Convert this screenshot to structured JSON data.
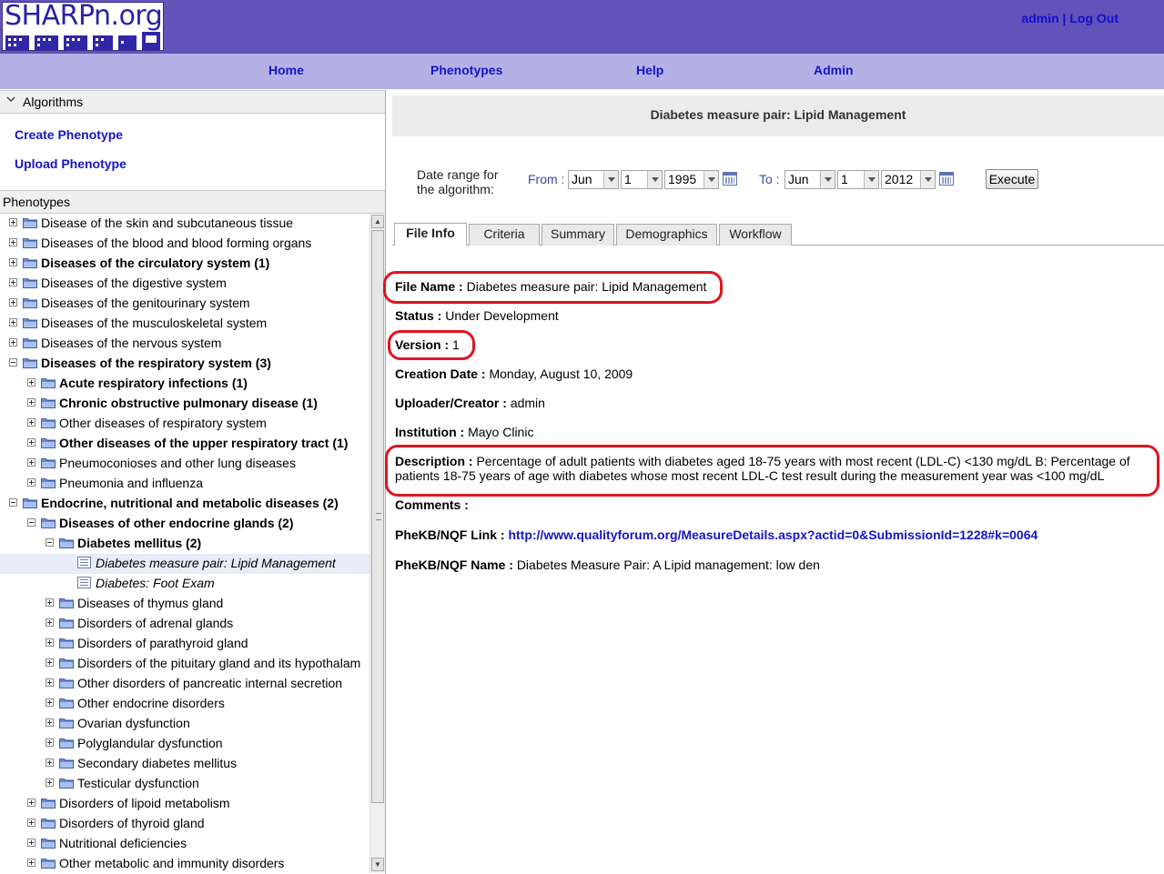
{
  "header": {
    "logo_text": "SHARPn.org",
    "user": "admin",
    "separator": "|",
    "logout": "Log Out"
  },
  "nav": {
    "items": [
      "Home",
      "Phenotypes",
      "Help",
      "Admin"
    ]
  },
  "algorithms": {
    "title": "Algorithms",
    "links": [
      "Create Phenotype",
      "Upload Phenotype"
    ]
  },
  "phenotypes": {
    "title": "Phenotypes",
    "tree": [
      {
        "label": "Disease of the skin and subcutaneous tissue",
        "level": 0,
        "type": "folder",
        "state": "collapsed",
        "bold": false
      },
      {
        "label": "Diseases of the blood and blood forming organs",
        "level": 0,
        "type": "folder",
        "state": "collapsed",
        "bold": false
      },
      {
        "label": "Diseases of the circulatory system (1)",
        "level": 0,
        "type": "folder",
        "state": "collapsed",
        "bold": true
      },
      {
        "label": "Diseases of the digestive system",
        "level": 0,
        "type": "folder",
        "state": "collapsed",
        "bold": false
      },
      {
        "label": "Diseases of the genitourinary system",
        "level": 0,
        "type": "folder",
        "state": "collapsed",
        "bold": false
      },
      {
        "label": "Diseases of the musculoskeletal system",
        "level": 0,
        "type": "folder",
        "state": "collapsed",
        "bold": false
      },
      {
        "label": "Diseases of the nervous system",
        "level": 0,
        "type": "folder",
        "state": "collapsed",
        "bold": false
      },
      {
        "label": "Diseases of the respiratory system (3)",
        "level": 0,
        "type": "folder",
        "state": "expanded",
        "bold": true
      },
      {
        "label": "Acute respiratory infections (1)",
        "level": 1,
        "type": "folder",
        "state": "collapsed",
        "bold": true
      },
      {
        "label": "Chronic obstructive pulmonary disease (1)",
        "level": 1,
        "type": "folder",
        "state": "collapsed",
        "bold": true
      },
      {
        "label": "Other diseases of respiratory system",
        "level": 1,
        "type": "folder",
        "state": "collapsed",
        "bold": false
      },
      {
        "label": "Other diseases of the upper respiratory tract (1)",
        "level": 1,
        "type": "folder",
        "state": "collapsed",
        "bold": true
      },
      {
        "label": "Pneumoconioses and other lung diseases",
        "level": 1,
        "type": "folder",
        "state": "collapsed",
        "bold": false
      },
      {
        "label": "Pneumonia and influenza",
        "level": 1,
        "type": "folder",
        "state": "collapsed",
        "bold": false
      },
      {
        "label": "Endocrine, nutritional and metabolic diseases (2)",
        "level": 0,
        "type": "folder",
        "state": "expanded",
        "bold": true
      },
      {
        "label": "Diseases of other endocrine glands (2)",
        "level": 1,
        "type": "folder",
        "state": "expanded",
        "bold": true
      },
      {
        "label": "Diabetes mellitus (2)",
        "level": 2,
        "type": "folder",
        "state": "expanded",
        "bold": true
      },
      {
        "label": "Diabetes measure pair: Lipid Management",
        "level": 3,
        "type": "doc",
        "italic": true,
        "selected": true
      },
      {
        "label": "Diabetes: Foot Exam",
        "level": 3,
        "type": "doc",
        "italic": true
      },
      {
        "label": "Diseases of thymus gland",
        "level": 2,
        "type": "folder",
        "state": "collapsed",
        "bold": false
      },
      {
        "label": "Disorders of adrenal glands",
        "level": 2,
        "type": "folder",
        "state": "collapsed",
        "bold": false
      },
      {
        "label": "Disorders of parathyroid gland",
        "level": 2,
        "type": "folder",
        "state": "collapsed",
        "bold": false
      },
      {
        "label": "Disorders of the pituitary gland and its hypothalam",
        "level": 2,
        "type": "folder",
        "state": "collapsed",
        "bold": false
      },
      {
        "label": "Other disorders of pancreatic internal secretion",
        "level": 2,
        "type": "folder",
        "state": "collapsed",
        "bold": false
      },
      {
        "label": "Other endocrine disorders",
        "level": 2,
        "type": "folder",
        "state": "collapsed",
        "bold": false
      },
      {
        "label": "Ovarian dysfunction",
        "level": 2,
        "type": "folder",
        "state": "collapsed",
        "bold": false
      },
      {
        "label": "Polyglandular dysfunction",
        "level": 2,
        "type": "folder",
        "state": "collapsed",
        "bold": false
      },
      {
        "label": "Secondary diabetes mellitus",
        "level": 2,
        "type": "folder",
        "state": "collapsed",
        "bold": false
      },
      {
        "label": "Testicular dysfunction",
        "level": 2,
        "type": "folder",
        "state": "collapsed",
        "bold": false
      },
      {
        "label": "Disorders of lipoid metabolism",
        "level": 1,
        "type": "folder",
        "state": "collapsed",
        "bold": false
      },
      {
        "label": "Disorders of thyroid gland",
        "level": 1,
        "type": "folder",
        "state": "collapsed",
        "bold": false
      },
      {
        "label": "Nutritional deficiencies",
        "level": 1,
        "type": "folder",
        "state": "collapsed",
        "bold": false
      },
      {
        "label": "Other metabolic and immunity disorders",
        "level": 1,
        "type": "folder",
        "state": "collapsed",
        "bold": false
      }
    ]
  },
  "detail": {
    "title": "Diabetes measure pair: Lipid Management",
    "date_range_label": "Date range for the algorithm:",
    "from_label": "From :",
    "to_label": "To :",
    "from": {
      "month": "Jun",
      "day": "1",
      "year": "1995"
    },
    "to": {
      "month": "Jun",
      "day": "1",
      "year": "2012"
    },
    "execute": "Execute",
    "tabs": [
      "File Info",
      "Criteria",
      "Summary",
      "Demographics",
      "Workflow"
    ],
    "active_tab": "File Info",
    "fields": {
      "file_name": {
        "label": "File Name :",
        "value": "Diabetes measure pair: Lipid Management"
      },
      "status": {
        "label": "Status :",
        "value": "Under Development"
      },
      "version": {
        "label": "Version :",
        "value": "1"
      },
      "creation_date": {
        "label": "Creation Date :",
        "value": "Monday, August 10, 2009"
      },
      "uploader": {
        "label": "Uploader/Creator :",
        "value": "admin"
      },
      "institution": {
        "label": "Institution :",
        "value": "Mayo Clinic"
      },
      "description": {
        "label": "Description :",
        "value": "Percentage of adult patients with diabetes aged 18-75 years with most recent (LDL-C) <130 mg/dL B: Percentage of patients 18-75 years of age with diabetes whose most recent LDL-C test result during the measurement year was <100 mg/dL"
      },
      "comments": {
        "label": "Comments :",
        "value": ""
      },
      "phekb_link": {
        "label": "PheKB/NQF Link :",
        "value": "http://www.qualityforum.org/MeasureDetails.aspx?actid=0&SubmissionId=1228#k=0064"
      },
      "phekb_name": {
        "label": "PheKB/NQF Name :",
        "value": "Diabetes Measure Pair: A Lipid management: low den"
      }
    }
  },
  "colors": {
    "header_bg": "#6352b9",
    "nav_bg": "#b5b1e6",
    "link": "#1515c8",
    "highlight": "#e0141e"
  }
}
